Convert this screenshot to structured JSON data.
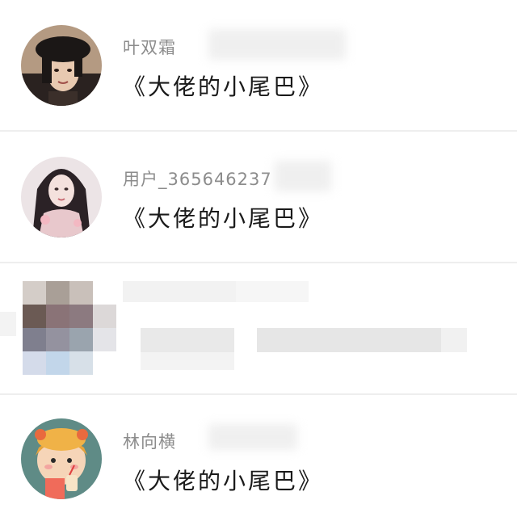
{
  "comments": [
    {
      "username": "叶双霜",
      "text": "《大佬的小尾巴》"
    },
    {
      "username": "用户_365646237",
      "text": "《大佬的小尾巴》"
    },
    {
      "username": "",
      "text": ""
    },
    {
      "username": "林向横",
      "text": "《大佬的小尾巴》"
    }
  ],
  "colors": {
    "background": "#ffffff",
    "username": "#8c8c8c",
    "comment_text": "#1a1a1a",
    "divider": "#eeeeee"
  },
  "icons": [
    "avatar-woman-black-hat",
    "avatar-woman-long-hair",
    "avatar-redacted-mosaic",
    "avatar-cartoon-child"
  ]
}
